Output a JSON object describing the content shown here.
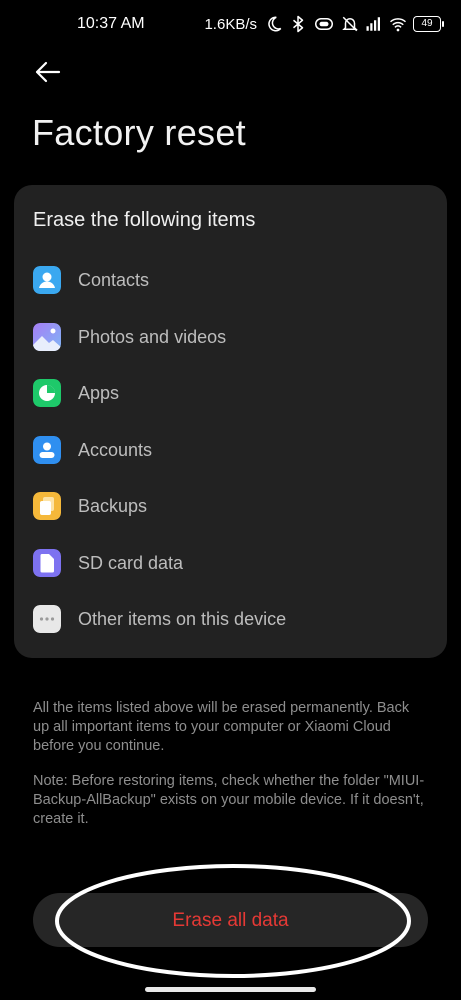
{
  "status_bar": {
    "time": "10:37 AM",
    "net_speed": "1.6KB/s",
    "battery": "49",
    "icons": [
      "moon-icon",
      "bluetooth-icon",
      "vibrate-icon",
      "mute-icon",
      "signal-icon",
      "wifi-icon",
      "battery-icon"
    ]
  },
  "header": {
    "back_icon": "back-arrow-icon",
    "title": "Factory reset"
  },
  "erase_card": {
    "title": "Erase the following items",
    "items": [
      {
        "label": "Contacts",
        "icon": "contacts-icon",
        "color": "#3aa8f0"
      },
      {
        "label": "Photos and videos",
        "icon": "photos-icon",
        "color": "#8b9cf5"
      },
      {
        "label": "Apps",
        "icon": "apps-icon",
        "color": "#1ec96a"
      },
      {
        "label": "Accounts",
        "icon": "accounts-icon",
        "color": "#2f8ff0"
      },
      {
        "label": "Backups",
        "icon": "backups-icon",
        "color": "#f5b83a"
      },
      {
        "label": "SD card data",
        "icon": "sd-card-icon",
        "color": "#7d72f0"
      },
      {
        "label": "Other items on this device",
        "icon": "more-icon",
        "color": "#e8e8e8"
      }
    ]
  },
  "notes": {
    "warning": "All the items listed above will be erased permanently. Back up all important items to your computer or Xiaomi Cloud before you continue.",
    "restore_note": "Note: Before restoring items, check whether the folder \"MIUI-Backup-AllBackup\" exists on your mobile device. If it doesn't, create it."
  },
  "actions": {
    "erase_label": "Erase all data",
    "erase_color": "#e53935"
  }
}
